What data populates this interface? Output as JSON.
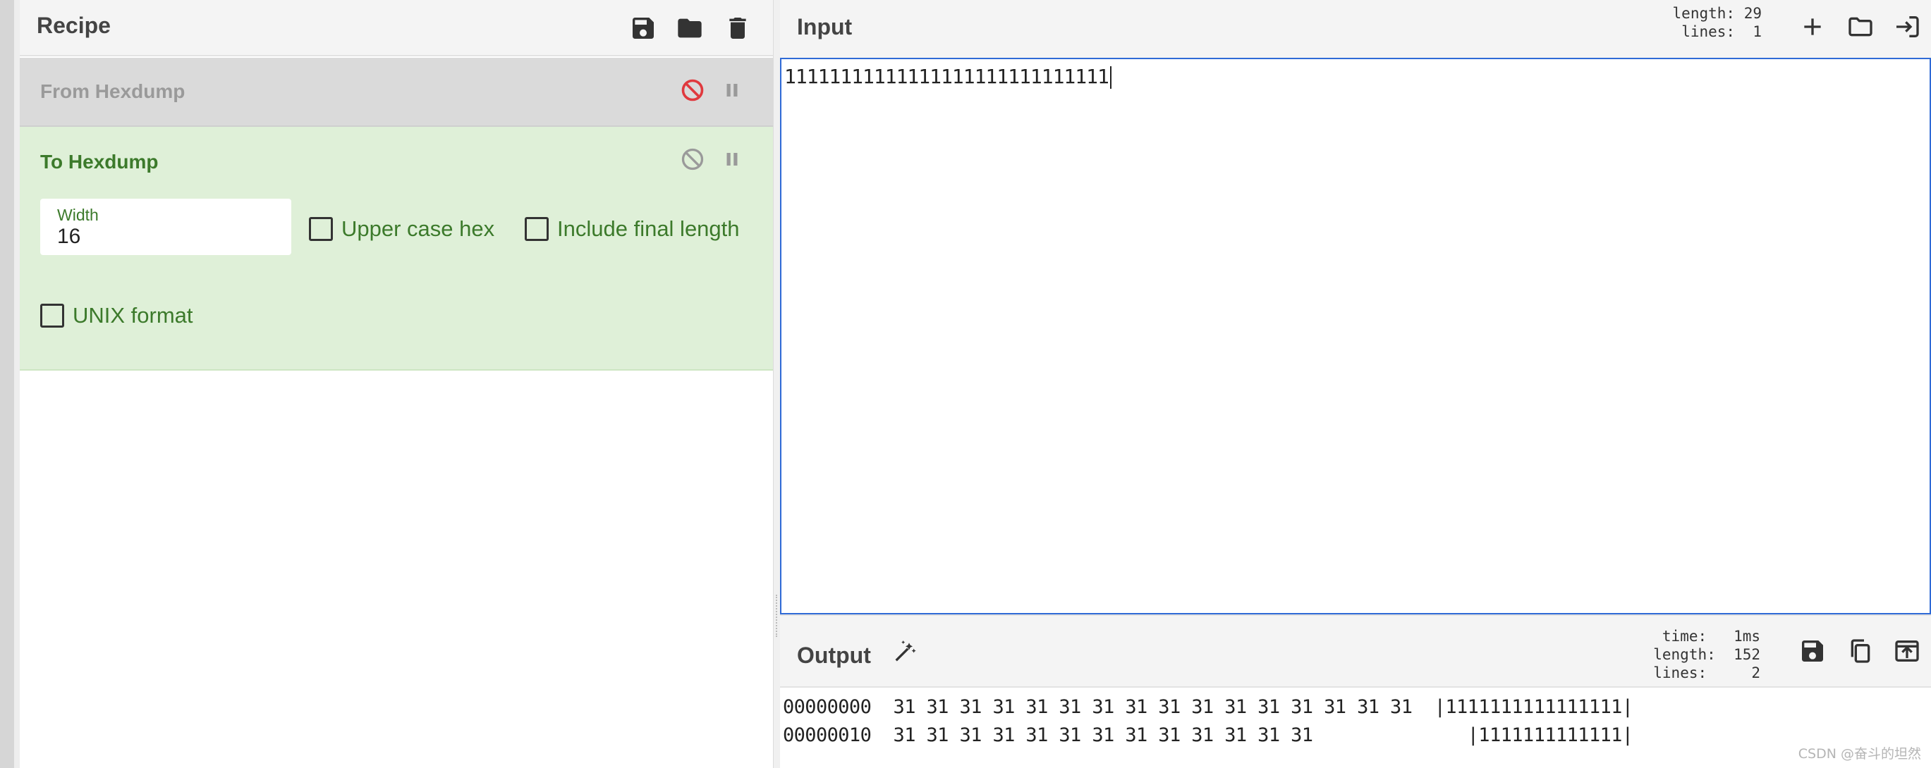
{
  "recipe": {
    "title": "Recipe",
    "icons": [
      "save-icon",
      "folder-icon",
      "trash-icon"
    ],
    "operations": [
      {
        "name": "From Hexdump",
        "disabled": true,
        "icons": [
          "disable-icon",
          "pause-icon"
        ]
      },
      {
        "name": "To Hexdump",
        "disabled": false,
        "icons": [
          "disable-icon",
          "pause-icon"
        ],
        "width_label": "Width",
        "width_value": "16",
        "options": [
          "Upper case hex",
          "Include final length",
          "UNIX format"
        ]
      }
    ]
  },
  "input": {
    "title": "Input",
    "length_label": "length:",
    "length_value": "29",
    "lines_label": "lines:",
    "lines_value": "1",
    "text": "11111111111111111111111111111",
    "icons": [
      "plus-icon",
      "folder-icon",
      "load-file-icon"
    ]
  },
  "output": {
    "title": "Output",
    "time_label": "time:",
    "time_value": "1ms",
    "length_label": "length:",
    "length_value": "152",
    "lines_label": "lines:",
    "lines_value": "2",
    "text": "00000000  31 31 31 31 31 31 31 31 31 31 31 31 31 31 31 31  |1111111111111111|\n00000010  31 31 31 31 31 31 31 31 31 31 31 31 31              |1111111111111|",
    "icons": [
      "magic-wand-icon",
      "save-icon",
      "copy-icon",
      "replace-input-icon"
    ]
  },
  "watermark": "CSDN @奋斗的坦然",
  "colors": {
    "accent_green": "#3c7a2b",
    "op_disabled_bg": "#dadada",
    "op_active_bg": "#dff0d8",
    "input_border": "#2f6ad6",
    "disable_red": "#e0393e"
  }
}
